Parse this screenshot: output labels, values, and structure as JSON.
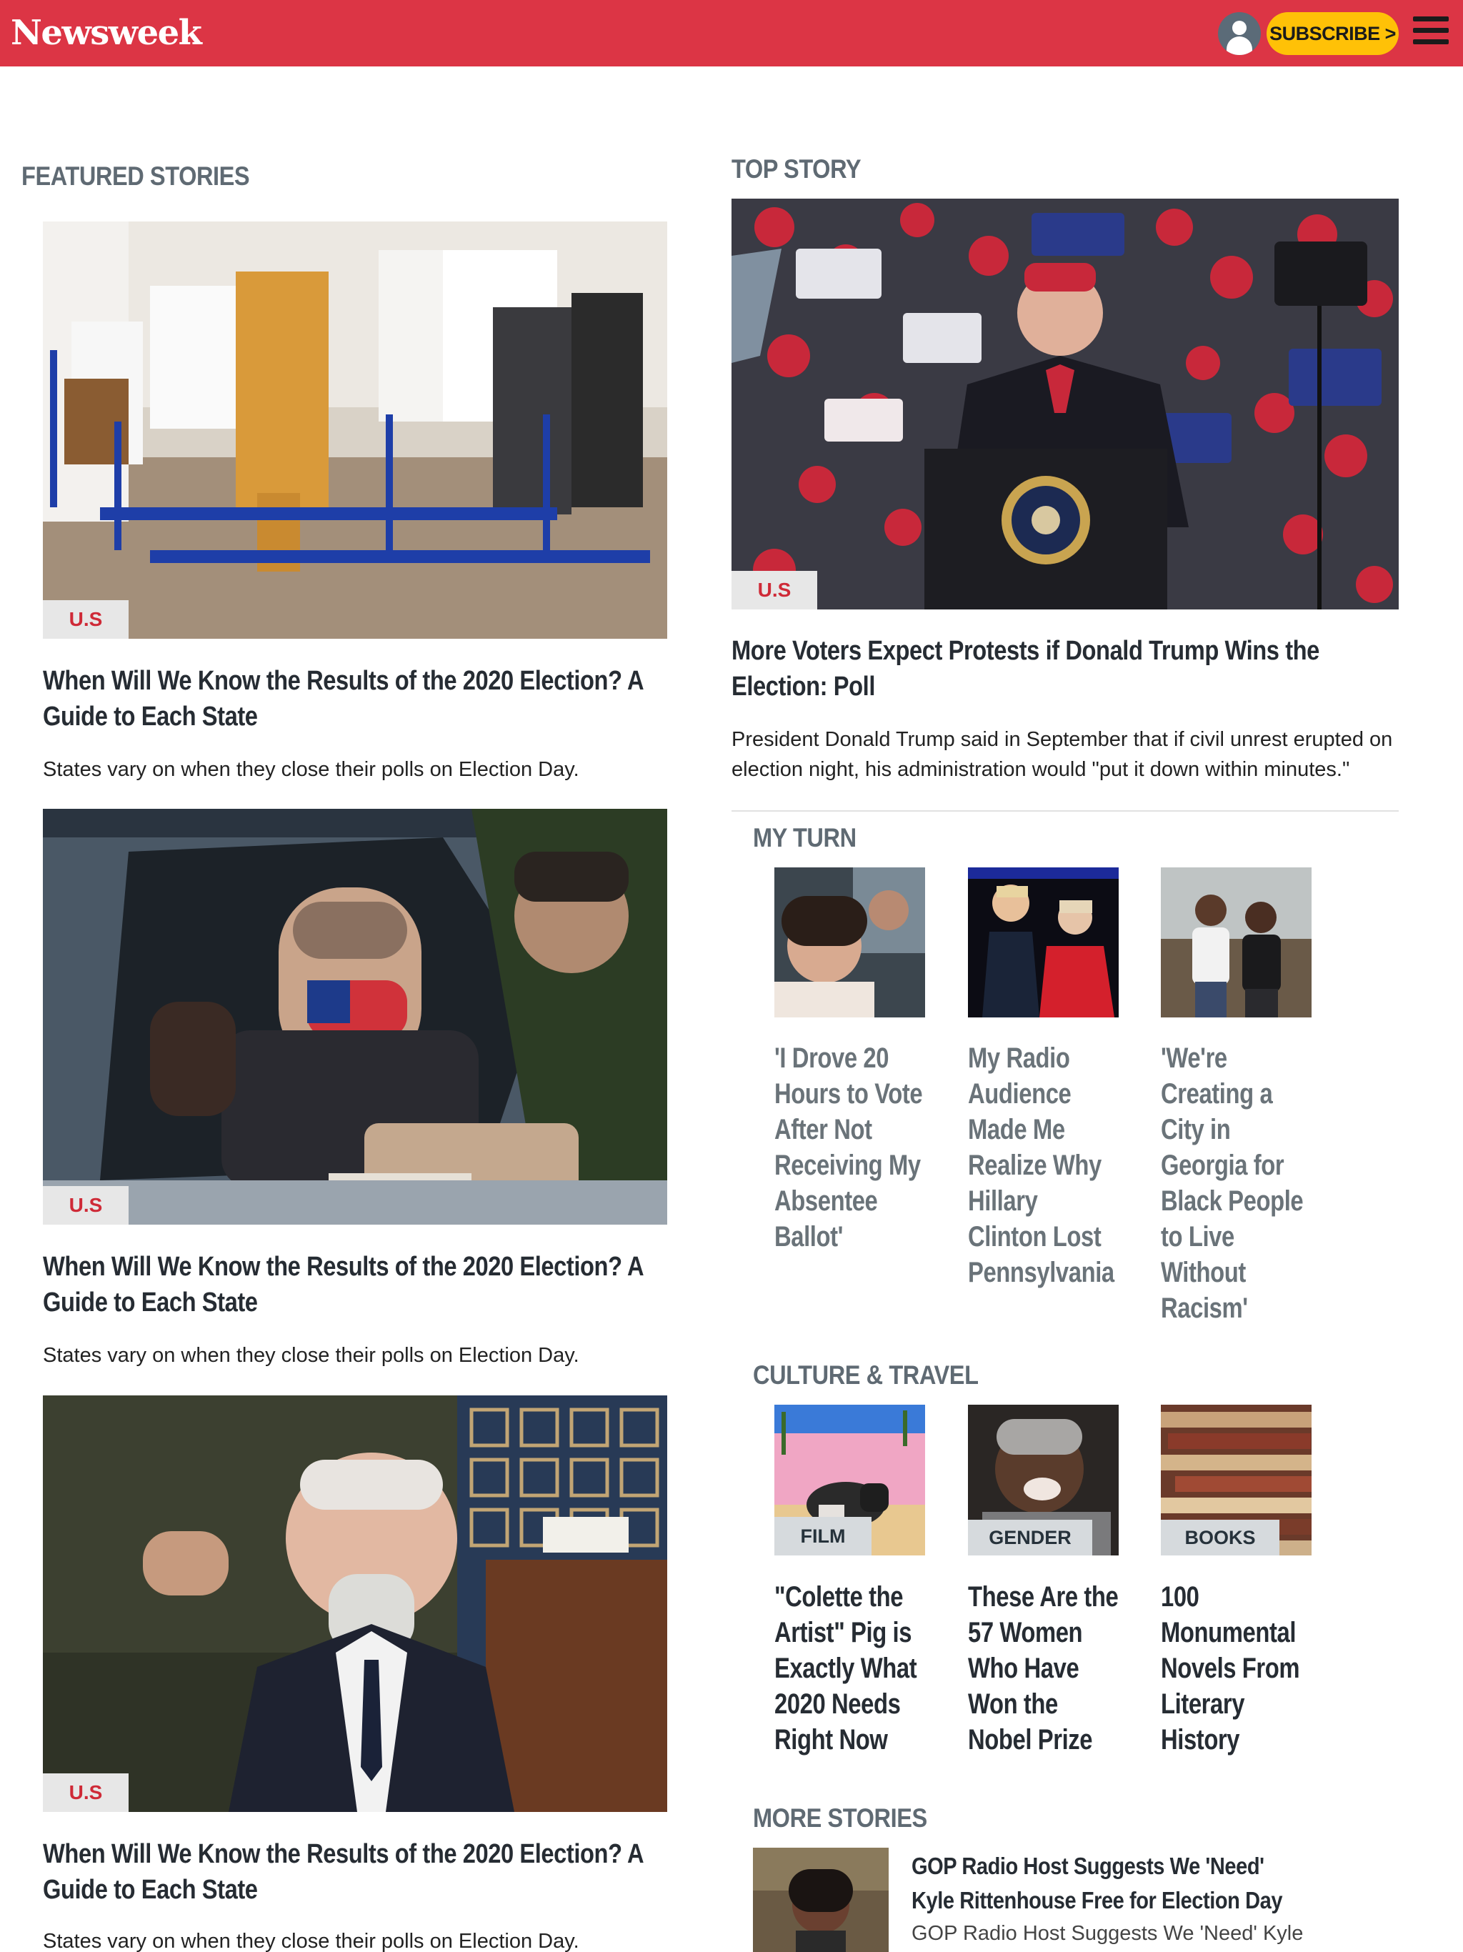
{
  "header": {
    "logo": "Newsweek",
    "subscribe_label": "SUBSCRIBE >"
  },
  "featured": {
    "title": "FEATURED STORIES",
    "stories": [
      {
        "tag": "U.S",
        "headline": "When Will We Know the Results of the 2020 Election? A Guide to Each State",
        "dek": "States vary on when they close their polls on Election Day."
      },
      {
        "tag": "U.S",
        "headline": "When Will We Know the Results of the 2020 Election? A Guide to Each State",
        "dek": "States vary on when they close their polls on Election Day."
      },
      {
        "tag": "U.S",
        "headline": "When Will We Know the Results of the 2020 Election? A Guide to Each State",
        "dek": "States vary on when they close their polls on Election Day."
      }
    ]
  },
  "top_story": {
    "title": "TOP STORY",
    "tag": "U.S",
    "headline": "More Voters Expect Protests if Donald Trump Wins the Election: Poll",
    "dek": "President Donald Trump said in September that if civil unrest erupted on election night, his administration would \"put it down within minutes.\""
  },
  "my_turn": {
    "title": "MY TURN",
    "items": [
      {
        "headline": "'I Drove 20 Hours to Vote After Not Receiving My Absentee Ballot'"
      },
      {
        "headline": "My Radio Audience Made Me Realize Why Hillary Clinton Lost Pennsylvania"
      },
      {
        "headline": "'We're Creating a City in Georgia for Black People to Live Without Racism'"
      }
    ]
  },
  "culture": {
    "title": "CULTURE & TRAVEL",
    "items": [
      {
        "tag": "FILM",
        "headline": "\"Colette the Artist\" Pig is Exactly What 2020 Needs Right Now"
      },
      {
        "tag": "GENDER",
        "headline": "These Are the 57 Women Who Have Won the Nobel Prize"
      },
      {
        "tag": "BOOKS",
        "headline": "100 Monumental Novels From Literary History"
      }
    ]
  },
  "more_stories": {
    "title": "MORE STORIES",
    "items": [
      {
        "headline": "GOP Radio Host Suggests We 'Need' Kyle Rittenhouse Free for Election Day",
        "dek": "GOP Radio Host Suggests We 'Need' Kyle"
      }
    ]
  },
  "colors": {
    "brand_red": "#dc3545",
    "subscribe_yellow": "#ffc107",
    "tag_red": "#cf2a37",
    "section_gray": "#5f6a73"
  },
  "icons": [
    "user-avatar-icon",
    "hamburger-menu-icon"
  ]
}
